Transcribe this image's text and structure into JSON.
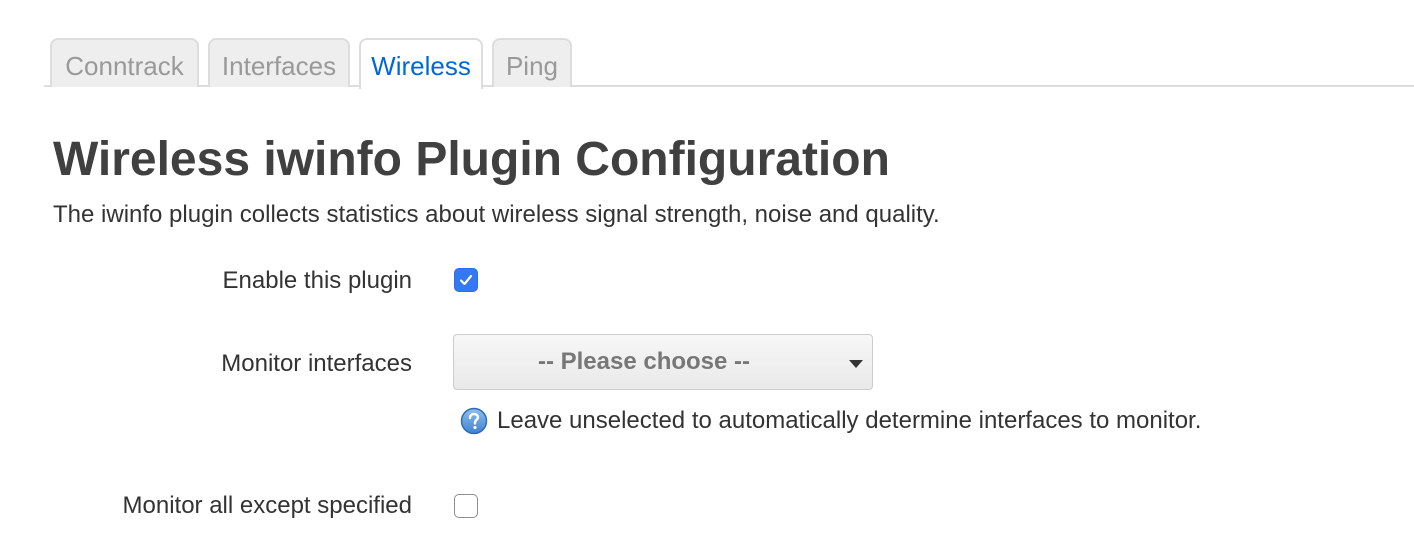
{
  "tabs": [
    {
      "label": "Conntrack",
      "active": false
    },
    {
      "label": "Interfaces",
      "active": false
    },
    {
      "label": "Wireless",
      "active": true
    },
    {
      "label": "Ping",
      "active": false
    }
  ],
  "page": {
    "title": "Wireless iwinfo Plugin Configuration",
    "description": "The iwinfo plugin collects statistics about wireless signal strength, noise and quality."
  },
  "form": {
    "enable": {
      "label": "Enable this plugin",
      "checked": true
    },
    "monitor_interfaces": {
      "label": "Monitor interfaces",
      "selected": "-- Please choose --",
      "help_icon": "help-icon",
      "help": "Leave unselected to automatically determine interfaces to monitor."
    },
    "monitor_except": {
      "label": "Monitor all except specified",
      "checked": false
    }
  },
  "colors": {
    "accent": "#0069d6",
    "checkbox_checked": "#3478f6",
    "help_icon": "#4a90d9"
  }
}
